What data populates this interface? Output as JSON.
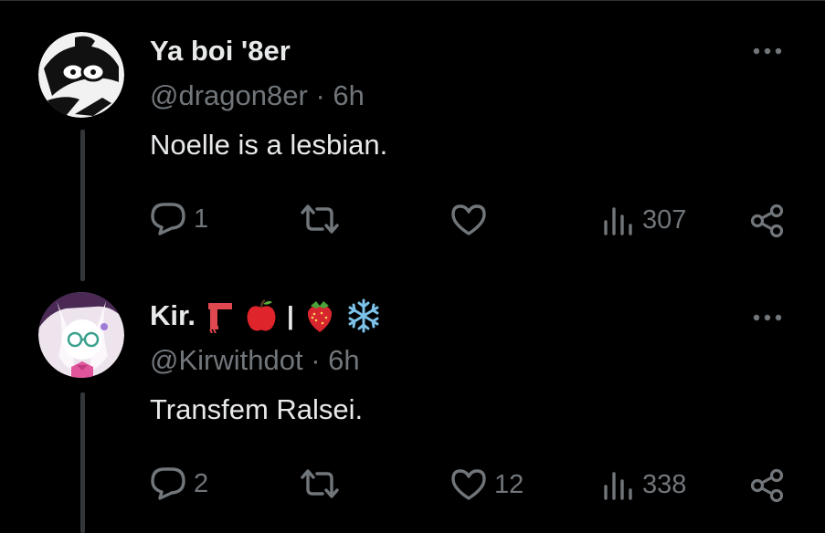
{
  "tweets": [
    {
      "name": "Ya boi '8er",
      "handle": "@dragon8er",
      "separator": "·",
      "time": "6h",
      "text": "Noelle is a lesbian.",
      "replies": "1",
      "retweets": "",
      "likes": "",
      "views": "307"
    },
    {
      "name": "Kir.",
      "name_emojis": [
        "scarf-emoji",
        "red-apple-emoji",
        "separator-bar",
        "strawberry-emoji",
        "snowflake-emoji"
      ],
      "name_bar": "|",
      "handle": "@Kirwithdot",
      "separator": "·",
      "time": "6h",
      "text": "Transfem Ralsei.",
      "replies": "2",
      "retweets": "",
      "likes": "12",
      "views": "338"
    }
  ],
  "colors": {
    "background": "#000000",
    "primary_text": "#e7e9ea",
    "secondary_text": "#71767b",
    "thread_line": "#333639"
  },
  "icons": [
    "reply-icon",
    "retweet-icon",
    "like-icon",
    "views-icon",
    "share-icon",
    "more-options-icon"
  ]
}
